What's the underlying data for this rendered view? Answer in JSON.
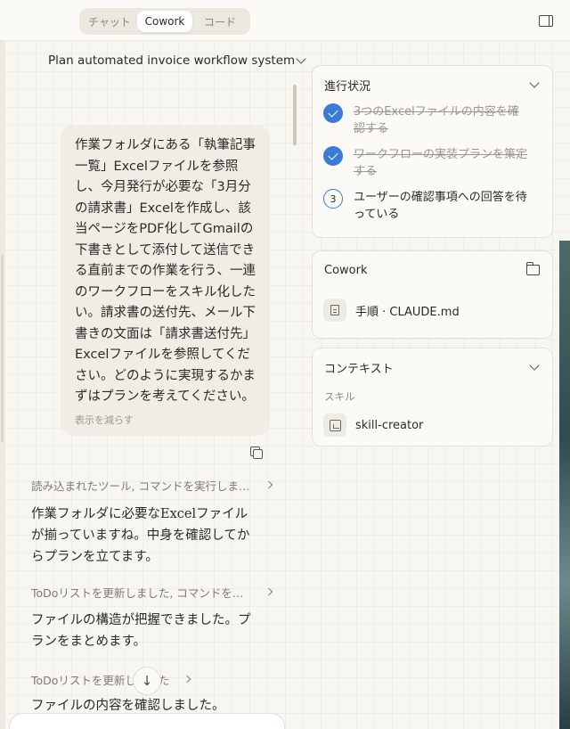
{
  "tabs": [
    {
      "label": "チャット",
      "active": false
    },
    {
      "label": "Cowork",
      "active": true
    },
    {
      "label": "コード",
      "active": false
    }
  ],
  "conversation": {
    "title": "Plan automated invoice workflow system",
    "user_message": "作業フォルダにある「執筆記事一覧」Excelファイルを参照し、今月発行が必要な「3月分の請求書」Excelを作成し、該当ページをPDF化してGmailの下書きとして添付して送信できる直前までの作業を行う、一連のワークフローをスキル化したい。請求書の送付先、メール下書きの文面は「請求書送付先」Excelファイルを参照してください。どのように実現するかまずはプランを考えてください。",
    "show_less": "表示を減らす",
    "events": [
      {
        "tool_summary": "読み込まれたツール, コマンドを実行しました",
        "reply": "作業フォルダに必要なExcelファイルが揃っていますね。中身を確認してからプランを立てます。"
      },
      {
        "tool_summary": "ToDoリストを更新しました, コマンドを実行しました",
        "reply": "ファイルの構造が把握できました。プランをまとめます。"
      },
      {
        "tool_summary": "ToDoリストを更新しました",
        "reply": "ファイルの内容を確認しました。"
      }
    ],
    "scroll_down_glyph": "↓"
  },
  "progress": {
    "title": "進行状況",
    "steps": [
      {
        "text": "3つのExcelファイルの内容を確認する",
        "done": true
      },
      {
        "text": "ワークフローの実装プランを策定する",
        "done": true
      },
      {
        "number": "3",
        "text": "ユーザーの確認事項への回答を待っている",
        "done": false
      }
    ]
  },
  "cowork": {
    "title": "Cowork",
    "file": "手順 · CLAUDE.md"
  },
  "context": {
    "title": "コンテキスト",
    "section_label": "スキル",
    "skill": "skill-creator"
  },
  "colors": {
    "accent": "#3a7bd5",
    "background": "#f8f6f1",
    "bubble": "#efede6"
  }
}
